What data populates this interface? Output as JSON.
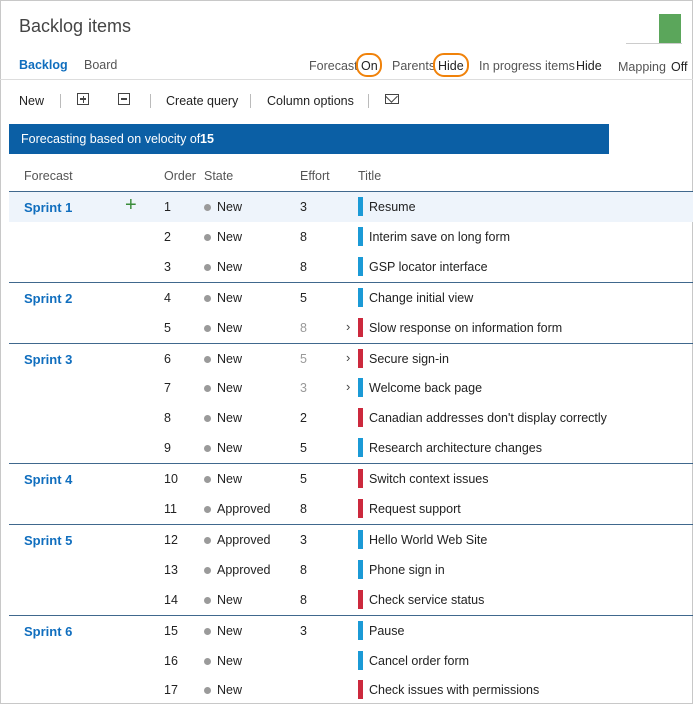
{
  "header": {
    "title": "Backlog items"
  },
  "hub": {
    "tabs": [
      "Backlog",
      "Board"
    ],
    "options": {
      "forecast_label": "Forecast",
      "forecast_value": "On",
      "parents_label": "Parents",
      "parents_value": "Hide",
      "in_progress_label": "In progress items",
      "in_progress_value": "Hide",
      "mapping_label": "Mapping",
      "mapping_value": "Off"
    }
  },
  "toolbar": {
    "new_label": "New",
    "create_query_label": "Create query",
    "column_options_label": "Column options"
  },
  "banner": {
    "text": "Forecasting based on velocity of",
    "velocity": "15"
  },
  "columns": {
    "forecast": "Forecast",
    "order": "Order",
    "state": "State",
    "effort": "Effort",
    "title": "Title"
  },
  "colors": {
    "story": "#1b9ad6",
    "bug": "#cc293d",
    "accent": "#0b5fa5",
    "highlight": "#f0820a"
  },
  "sprints": [
    {
      "name": "Sprint 1",
      "items": [
        {
          "order": "1",
          "state": "New",
          "effort": "3",
          "title": "Resume",
          "type": "story"
        },
        {
          "order": "2",
          "state": "New",
          "effort": "8",
          "title": "Interim save on long form",
          "type": "story"
        },
        {
          "order": "3",
          "state": "New",
          "effort": "8",
          "title": "GSP locator interface",
          "type": "story"
        }
      ]
    },
    {
      "name": "Sprint 2",
      "items": [
        {
          "order": "4",
          "state": "New",
          "effort": "5",
          "title": "Change initial view",
          "type": "story"
        },
        {
          "order": "5",
          "state": "New",
          "effort": "8",
          "title": "Slow response on information form",
          "type": "bug",
          "expandable": true
        }
      ]
    },
    {
      "name": "Sprint 3",
      "items": [
        {
          "order": "6",
          "state": "New",
          "effort": "5",
          "title": "Secure sign-in",
          "type": "bug",
          "expandable": true
        },
        {
          "order": "7",
          "state": "New",
          "effort": "3",
          "title": "Welcome back page",
          "type": "story",
          "expandable": true
        },
        {
          "order": "8",
          "state": "New",
          "effort": "2",
          "title": "Canadian addresses don't display correctly",
          "type": "bug"
        },
        {
          "order": "9",
          "state": "New",
          "effort": "5",
          "title": "Research architecture changes",
          "type": "story"
        }
      ]
    },
    {
      "name": "Sprint 4",
      "items": [
        {
          "order": "10",
          "state": "New",
          "effort": "5",
          "title": "Switch context issues",
          "type": "bug"
        },
        {
          "order": "11",
          "state": "Approved",
          "effort": "8",
          "title": "Request support",
          "type": "bug"
        }
      ]
    },
    {
      "name": "Sprint 5",
      "items": [
        {
          "order": "12",
          "state": "Approved",
          "effort": "3",
          "title": "Hello World Web Site",
          "type": "story"
        },
        {
          "order": "13",
          "state": "Approved",
          "effort": "8",
          "title": "Phone sign in",
          "type": "story"
        },
        {
          "order": "14",
          "state": "New",
          "effort": "8",
          "title": "Check service status",
          "type": "bug"
        }
      ]
    },
    {
      "name": "Sprint 6",
      "items": [
        {
          "order": "15",
          "state": "New",
          "effort": "3",
          "title": "Pause",
          "type": "story"
        },
        {
          "order": "16",
          "state": "New",
          "effort": "",
          "title": "Cancel order form",
          "type": "story"
        },
        {
          "order": "17",
          "state": "New",
          "effort": "",
          "title": "Check issues with permissions",
          "type": "bug"
        }
      ]
    }
  ]
}
